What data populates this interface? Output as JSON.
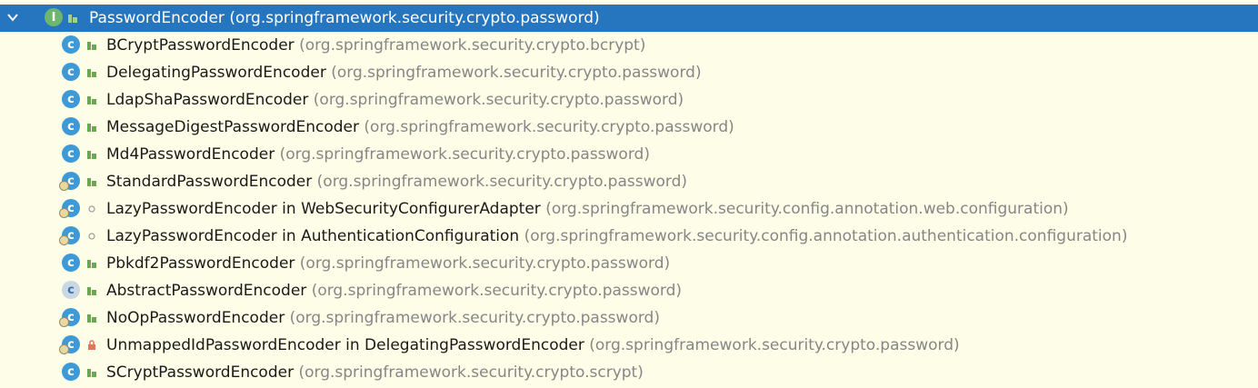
{
  "hierarchy": {
    "root": {
      "name": "PasswordEncoder",
      "package": "(org.springframework.security.crypto.password)",
      "kind": "interface",
      "visibility": "public"
    },
    "children": [
      {
        "name": "BCryptPasswordEncoder",
        "package": "(org.springframework.security.crypto.bcrypt)",
        "kind": "class",
        "visibility": "public"
      },
      {
        "name": "DelegatingPasswordEncoder",
        "package": "(org.springframework.security.crypto.password)",
        "kind": "class",
        "visibility": "public"
      },
      {
        "name": "LdapShaPasswordEncoder",
        "package": "(org.springframework.security.crypto.password)",
        "kind": "class",
        "visibility": "public"
      },
      {
        "name": "MessageDigestPasswordEncoder",
        "package": "(org.springframework.security.crypto.password)",
        "kind": "class",
        "visibility": "public"
      },
      {
        "name": "Md4PasswordEncoder",
        "package": "(org.springframework.security.crypto.password)",
        "kind": "class",
        "visibility": "public"
      },
      {
        "name": "StandardPasswordEncoder",
        "package": "(org.springframework.security.crypto.password)",
        "kind": "deprecated-class",
        "visibility": "public"
      },
      {
        "name": "LazyPasswordEncoder in WebSecurityConfigurerAdapter",
        "package": "(org.springframework.security.config.annotation.web.configuration)",
        "kind": "inner-class",
        "visibility": "package-private"
      },
      {
        "name": "LazyPasswordEncoder in AuthenticationConfiguration",
        "package": "(org.springframework.security.config.annotation.authentication.configuration)",
        "kind": "inner-class",
        "visibility": "package-private"
      },
      {
        "name": "Pbkdf2PasswordEncoder",
        "package": "(org.springframework.security.crypto.password)",
        "kind": "class",
        "visibility": "public"
      },
      {
        "name": "AbstractPasswordEncoder",
        "package": "(org.springframework.security.crypto.password)",
        "kind": "abstract-class",
        "visibility": "public"
      },
      {
        "name": "NoOpPasswordEncoder",
        "package": "(org.springframework.security.crypto.password)",
        "kind": "deprecated-class",
        "visibility": "public"
      },
      {
        "name": "UnmappedIdPasswordEncoder in DelegatingPasswordEncoder",
        "package": "(org.springframework.security.crypto.password)",
        "kind": "inner-class",
        "visibility": "private"
      },
      {
        "name": "SCryptPasswordEncoder",
        "package": "(org.springframework.security.crypto.scrypt)",
        "kind": "class",
        "visibility": "public"
      }
    ]
  },
  "icons": {
    "expand": "chevron-down-icon",
    "interface": "interface-icon",
    "class": "class-icon",
    "public": "public-visibility-icon",
    "private": "private-lock-icon",
    "package-private": "package-private-icon"
  },
  "colors": {
    "background": "#fefde8",
    "selection": "#2675bf",
    "class_icon": "#3d9ad6",
    "interface_icon": "#6fb66d",
    "public_icon": "#68a84f",
    "private_icon": "#e0785a",
    "package_text": "#868686"
  }
}
